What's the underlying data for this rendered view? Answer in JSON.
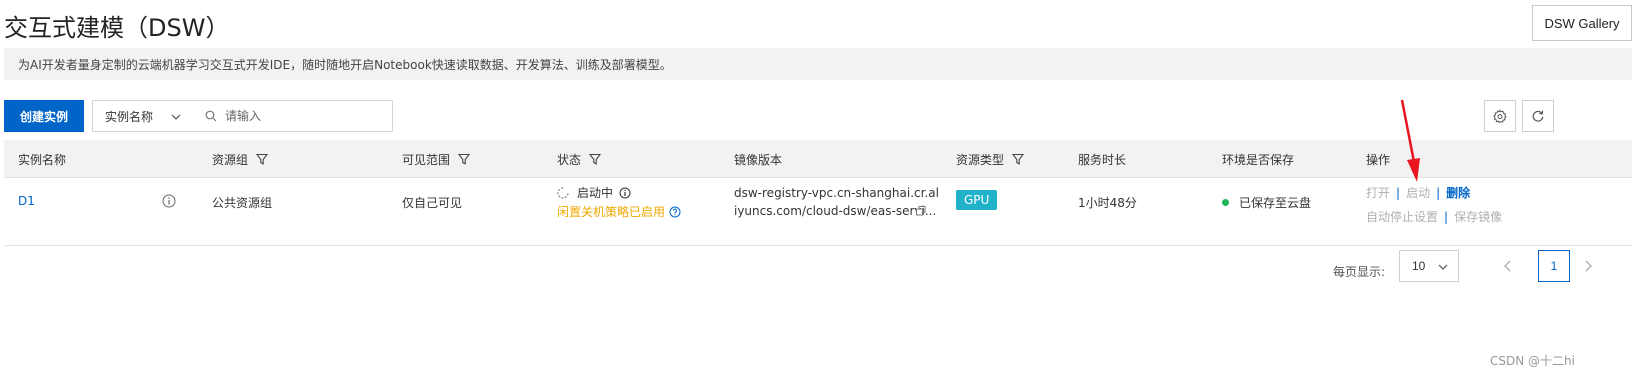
{
  "header": {
    "title": "交互式建模（DSW）",
    "gallery_button": "DSW Gallery"
  },
  "description": "为AI开发者量身定制的云端机器学习交互式开发IDE，随时随地开启Notebook快速读取数据、开发算法、训练及部署模型。",
  "toolbar": {
    "create_button": "创建实例",
    "filter_field": "实例名称",
    "search_placeholder": "请输入"
  },
  "table": {
    "columns": [
      {
        "label": "实例名称"
      },
      {
        "label": "资源组"
      },
      {
        "label": "可见范围"
      },
      {
        "label": "状态"
      },
      {
        "label": "镜像版本"
      },
      {
        "label": "资源类型"
      },
      {
        "label": "服务时长"
      },
      {
        "label": "环境是否保存"
      },
      {
        "label": "操作"
      }
    ],
    "rows": [
      {
        "name": "D1",
        "resource_group": "公共资源组",
        "visibility": "仅自己可见",
        "status": "启动中",
        "status_note": "闲置关机策略已启用",
        "image_line1": "dsw-registry-vpc.cn-shanghai.cr.al",
        "image_line2": "iyuncs.com/cloud-dsw/eas-servi...",
        "resource_type": "GPU",
        "duration": "1小时48分",
        "env_saved": "已保存至云盘",
        "actions": {
          "open": "打开",
          "start": "启动",
          "delete": "删除",
          "auto_stop": "自动停止设置",
          "save_image": "保存镜像"
        }
      }
    ]
  },
  "pagination": {
    "page_size_label": "每页显示:",
    "page_size": "10",
    "current_page": "1"
  },
  "watermark": "CSDN @十二hi",
  "colors": {
    "primary": "#0064c8",
    "gpu_badge": "#20b2c9",
    "saved_dot": "#1fb55a",
    "warning": "#f0a800",
    "arrow": "#e8141e"
  }
}
